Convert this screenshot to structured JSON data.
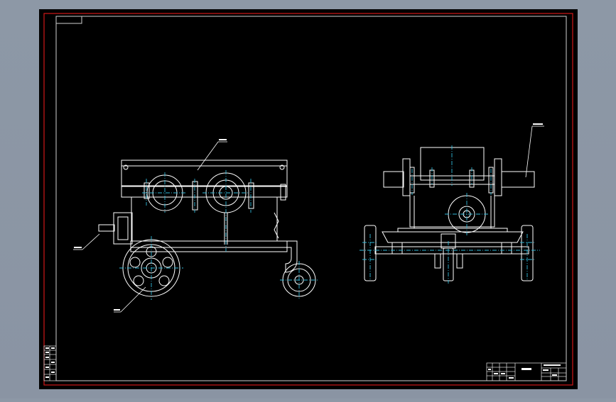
{
  "drawing": {
    "background_color": "#000000",
    "border_color": "#d01818",
    "line_color": "#ffffff",
    "centerline_color": "#2fb8d8",
    "frame_color": "#c8c8c8"
  },
  "callouts": {
    "top_label": "",
    "left_label": "",
    "bottom_label": "",
    "right_label": ""
  },
  "title_block": {
    "title_text": ""
  }
}
